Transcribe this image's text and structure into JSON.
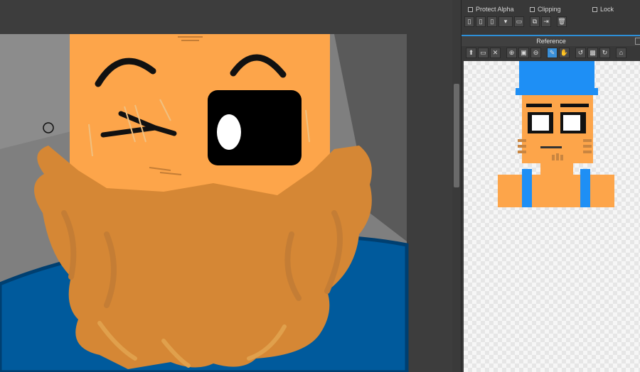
{
  "layer_options": {
    "protect_alpha": "Protect Alpha",
    "clipping": "Clipping",
    "lock": "Lock"
  },
  "reference": {
    "title": "Reference"
  },
  "icons": {
    "layer_tools": [
      "new-layer-icon",
      "new-layer-copy-icon",
      "new-layer-from-file-icon",
      "layer-mode-dropdown-icon",
      "new-folder-icon",
      "duplicate-layer-icon",
      "merge-layer-icon",
      "delete-layer-icon"
    ],
    "reference_tools": [
      "fill-icon",
      "open-folder-icon",
      "close-icon",
      "zoom-in-icon",
      "fit-icon",
      "zoom-out-icon",
      "pick-color-icon",
      "hand-icon",
      "rotate-left-icon",
      "fit-window-icon",
      "rotate-right-icon",
      "pin-icon"
    ]
  },
  "colors": {
    "accent": "#2d8fd8",
    "skin": "#fda54a",
    "beard": "#d58735",
    "shirt": "#005a9c",
    "hat": "#1e8ff5"
  }
}
